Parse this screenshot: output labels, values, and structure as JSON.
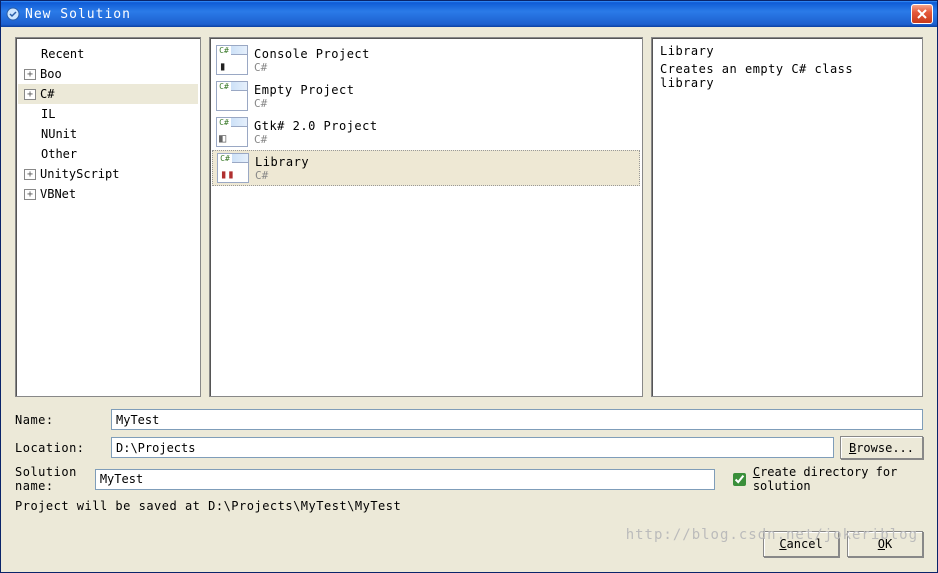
{
  "window": {
    "title": "New Solution"
  },
  "tree": {
    "items": [
      {
        "label": "Recent",
        "expandable": false,
        "selected": false,
        "indent": 1
      },
      {
        "label": "Boo",
        "expandable": true,
        "selected": false,
        "indent": 0
      },
      {
        "label": "C#",
        "expandable": true,
        "selected": true,
        "indent": 0
      },
      {
        "label": "IL",
        "expandable": false,
        "selected": false,
        "indent": 1
      },
      {
        "label": "NUnit",
        "expandable": false,
        "selected": false,
        "indent": 1
      },
      {
        "label": "Other",
        "expandable": false,
        "selected": false,
        "indent": 1
      },
      {
        "label": "UnityScript",
        "expandable": true,
        "selected": false,
        "indent": 0
      },
      {
        "label": "VBNet",
        "expandable": true,
        "selected": false,
        "indent": 0
      }
    ]
  },
  "templates": {
    "items": [
      {
        "name": "Console Project",
        "sub": "C#",
        "selected": false,
        "glyph": "▮",
        "glyph_color": "#222"
      },
      {
        "name": "Empty Project",
        "sub": "C#",
        "selected": false,
        "glyph": "",
        "glyph_color": "#222"
      },
      {
        "name": "Gtk# 2.0 Project",
        "sub": "C#",
        "selected": false,
        "glyph": "◧",
        "glyph_color": "#666"
      },
      {
        "name": "Library",
        "sub": "C#",
        "selected": true,
        "glyph": "▮▮",
        "glyph_color": "#b03030"
      }
    ]
  },
  "description": {
    "title": "Library",
    "body": "Creates an empty C# class library"
  },
  "form": {
    "name_label": "Name:",
    "name_value": "MyTest",
    "location_label": "Location:",
    "location_value": "D:\\Projects",
    "browse_label": "Browse...",
    "solution_label": "Solution name:",
    "solution_value": "MyTest",
    "create_dir_label": "Create directory for solution",
    "create_dir_checked": true,
    "hint": "Project will be saved at D:\\Projects\\MyTest\\MyTest"
  },
  "footer": {
    "cancel": "Cancel",
    "ok": "OK"
  },
  "watermark": "http://blog.csdn.net/jokeriblog"
}
